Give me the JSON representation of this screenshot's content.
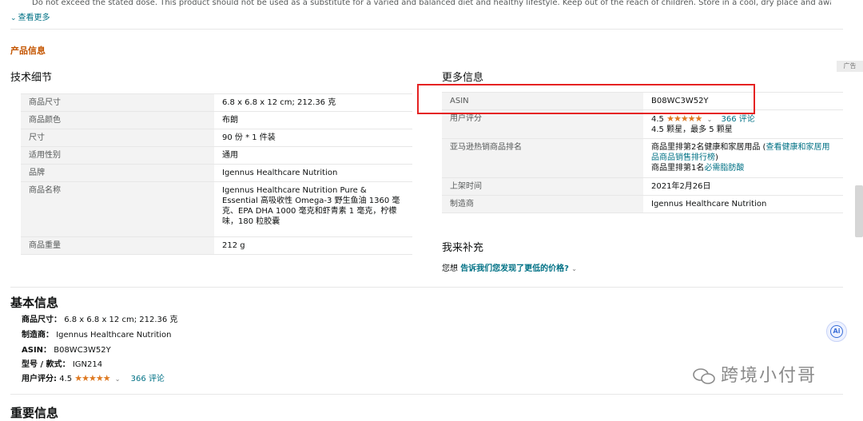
{
  "top_text": "Do not exceed the stated dose. This product should not be used as a substitute for a varied and balanced diet and healthy lifestyle. Keep out of the reach of children. Store in a cool, dry place and away from sunlight. Seek",
  "see_more": "查看更多",
  "product_info_title": "产品信息",
  "tech_details": {
    "title": "技术细节",
    "rows": [
      {
        "key": "商品尺寸",
        "value": "6.8 x 6.8 x 12 cm; 212.36 克"
      },
      {
        "key": "商品颜色",
        "value": "布朗"
      },
      {
        "key": "尺寸",
        "value": "90 份 * 1 件装"
      },
      {
        "key": "适用性别",
        "value": "通用"
      },
      {
        "key": "品牌",
        "value": "Igennus Healthcare Nutrition"
      },
      {
        "key": "商品名称",
        "value": "Igennus Healthcare Nutrition Pure & Essential 高吸收性 Omega-3 野生鱼油 1360 毫克、EPA DHA 1000 毫克和虾青素 1 毫克，柠檬味，180 粒胶囊"
      },
      {
        "key": "商品重量",
        "value": "212 g"
      }
    ]
  },
  "more_info": {
    "title": "更多信息",
    "asin_key": "ASIN",
    "asin_value": "B08WC3W52Y",
    "rating_key": "用户评分",
    "rating_value": "4.5",
    "stars": "★★★★★",
    "reviews_link": "366 评论",
    "rating_note": "4.5 颗星，最多 5 颗星",
    "rank_key": "亚马逊热销商品排名",
    "rank_line1_prefix": "商品里排第2名健康和家居用品 (",
    "rank_line1_link": "查看健康和家居用品商品销售排行榜",
    "rank_line1_suffix": ")",
    "rank_line2_prefix": "商品里排第1名",
    "rank_line2_link": "必需脂肪酸",
    "date_key": "上架时间",
    "date_value": "2021年2月26日",
    "maker_key": "制造商",
    "maker_value": "Igennus Healthcare Nutrition"
  },
  "feedback": {
    "title": "我来补充",
    "prefix": "您想",
    "link": "告诉我们您发现了更低的价格?"
  },
  "ad_label": "广告",
  "basic_info": {
    "title": "基本信息",
    "size_label": "商品尺寸：",
    "size_value": "6.8 x 6.8 x 12 cm; 212.36 克",
    "maker_label": "制造商：",
    "maker_value": "Igennus Healthcare Nutrition",
    "asin_label": "ASIN：",
    "asin_value": "B08WC3W52Y",
    "model_label": "型号 / 款式：",
    "model_value": "IGN214",
    "rating_label": "用户评分:",
    "rating_value": "4.5",
    "stars": "★★★★★",
    "reviews_link": "366 评论"
  },
  "ai_button": "Ai",
  "watermark": "跨境小付哥",
  "bottom_title": "重要信息",
  "colors": {
    "accent_orange": "#c45500",
    "link": "#007185",
    "star": "#de7921",
    "highlight_box": "#e52222"
  }
}
